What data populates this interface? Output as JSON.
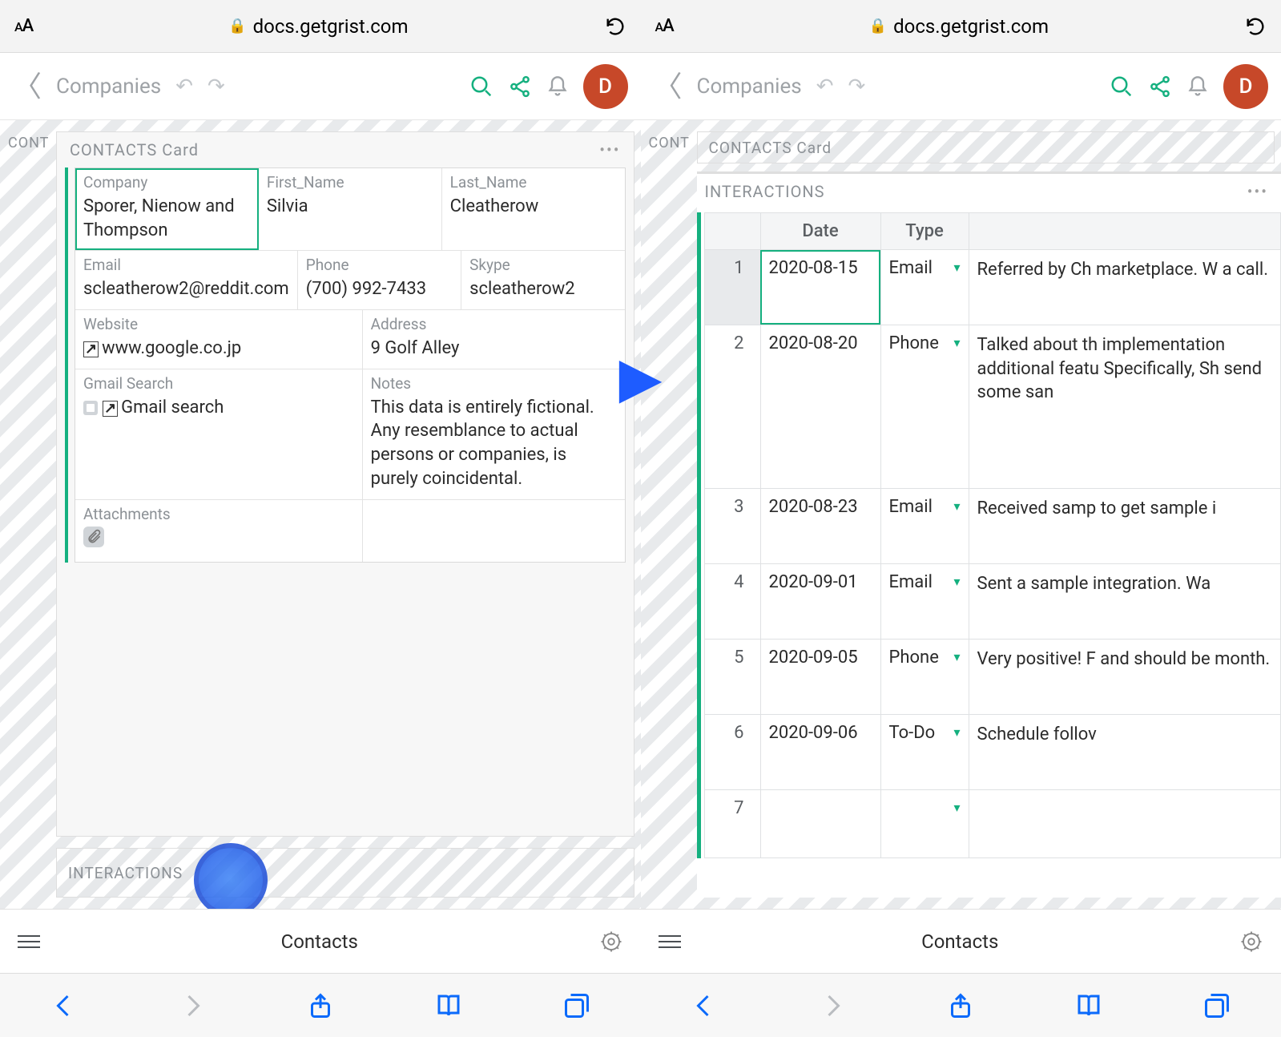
{
  "url": "docs.getgrist.com",
  "aa_small": "A",
  "aa_large": "A",
  "breadcrumb": "Companies",
  "avatar_letter": "D",
  "cont_tab": "CONT",
  "card_title": "CONTACTS Card",
  "card": {
    "company_label": "Company",
    "company": "Sporer, Nienow and Thompson",
    "first_label": "First_Name",
    "first": "Silvia",
    "last_label": "Last_Name",
    "last": "Cleatherow",
    "email_label": "Email",
    "email": "scleatherow2@reddit.com",
    "phone_label": "Phone",
    "phone": "(700) 992-7433",
    "skype_label": "Skype",
    "skype": "scleatherow2",
    "website_label": "Website",
    "website": "www.google.co.jp",
    "address_label": "Address",
    "address": "9 Golf Alley",
    "gmail_label": "Gmail Search",
    "gmail": "Gmail search",
    "notes_label": "Notes",
    "notes": "This data is entirely fictional. Any resemblance to actual persons or companies, is purely coincidental.",
    "attach_label": "Attachments"
  },
  "interactions_label": "INTERACTIONS",
  "bottom_title": "Contacts",
  "table": {
    "title_contacts": "CONTACTS Card",
    "title": "INTERACTIONS",
    "col_date": "Date",
    "col_type": "Type",
    "rows": [
      {
        "n": "1",
        "date": "2020-08-15",
        "type": "Email",
        "notes": "Referred by Ch marketplace. W a call."
      },
      {
        "n": "2",
        "date": "2020-08-20",
        "type": "Phone",
        "notes": "Talked about th implementation additional featu Specifically, Sh send some san"
      },
      {
        "n": "3",
        "date": "2020-08-23",
        "type": "Email",
        "notes": "Received samp to get sample i"
      },
      {
        "n": "4",
        "date": "2020-09-01",
        "type": "Email",
        "notes": "Sent a sample integration. Wa"
      },
      {
        "n": "5",
        "date": "2020-09-05",
        "type": "Phone",
        "notes": "Very positive! F and should be month."
      },
      {
        "n": "6",
        "date": "2020-09-06",
        "type": "To-Do",
        "notes": "Schedule follov"
      },
      {
        "n": "7",
        "date": "",
        "type": "",
        "notes": ""
      }
    ]
  }
}
